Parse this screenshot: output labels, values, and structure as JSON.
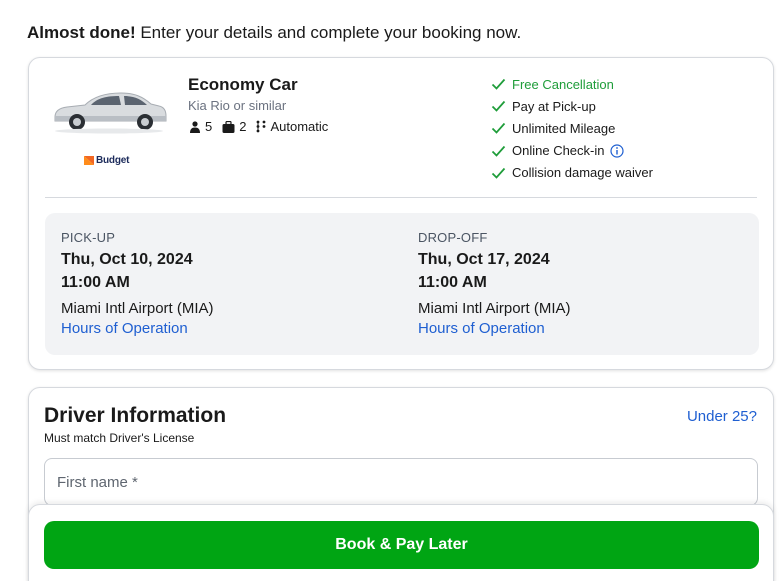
{
  "header": {
    "bold": "Almost done!",
    "rest": " Enter your details and complete your booking now."
  },
  "car": {
    "title": "Economy Car",
    "subtitle": "Kia Rio or similar",
    "seats": "5",
    "bags": "2",
    "transmission": "Automatic",
    "vendor": "Budget"
  },
  "features": [
    {
      "label": "Free Cancellation"
    },
    {
      "label": "Pay at Pick-up"
    },
    {
      "label": "Unlimited Mileage"
    },
    {
      "label": "Online Check-in"
    },
    {
      "label": "Collision damage waiver"
    }
  ],
  "pickup": {
    "label": "PICK-UP",
    "date": "Thu, Oct 10, 2024",
    "time": "11:00 AM",
    "location": "Miami Intl Airport (MIA)",
    "hours_link": "Hours of Operation"
  },
  "dropoff": {
    "label": "DROP-OFF",
    "date": "Thu, Oct 17, 2024",
    "time": "11:00 AM",
    "location": "Miami Intl Airport (MIA)",
    "hours_link": "Hours of Operation"
  },
  "driver": {
    "title": "Driver Information",
    "subtitle": "Must match Driver's License",
    "under25": "Under 25?",
    "first_name_placeholder": "First name *"
  },
  "book_button": "Book & Pay Later",
  "colors": {
    "accent_green": "#00a513",
    "feature_green": "#1f9d3a",
    "link_blue": "#1f5fd1"
  }
}
